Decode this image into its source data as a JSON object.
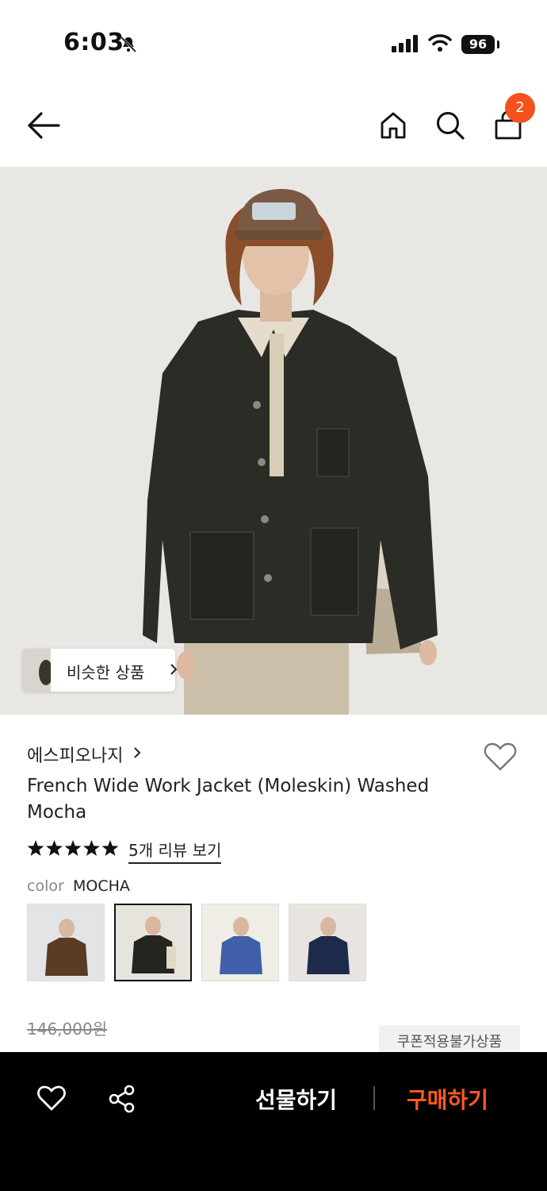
{
  "status_bar": {
    "time": "6:03",
    "battery": "96"
  },
  "nav": {
    "cart_count": "2"
  },
  "similar": {
    "label": "비슷한 상품"
  },
  "product": {
    "brand": "에스피오나지",
    "title": "French Wide Work Jacket (Moleskin) Washed Mocha",
    "rating_stars": 5,
    "review_link": "5개 리뷰 보기",
    "color_label": "color",
    "color_value": "MOCHA",
    "original_price": "146,000원",
    "coupon_badge": "쿠폰적용불가상품"
  },
  "bottom_bar": {
    "gift_label": "선물하기",
    "buy_label": "구매하기"
  },
  "colors": {
    "accent": "#f4511e",
    "buy_text": "#ff5a1f",
    "bar_bg": "#000000"
  },
  "icons": [
    "back-arrow-icon",
    "home-icon",
    "search-icon",
    "cart-icon",
    "heart-icon",
    "share-icon",
    "star-icon",
    "chevron-right-icon",
    "bell-off-icon",
    "signal-icon",
    "wifi-icon"
  ]
}
